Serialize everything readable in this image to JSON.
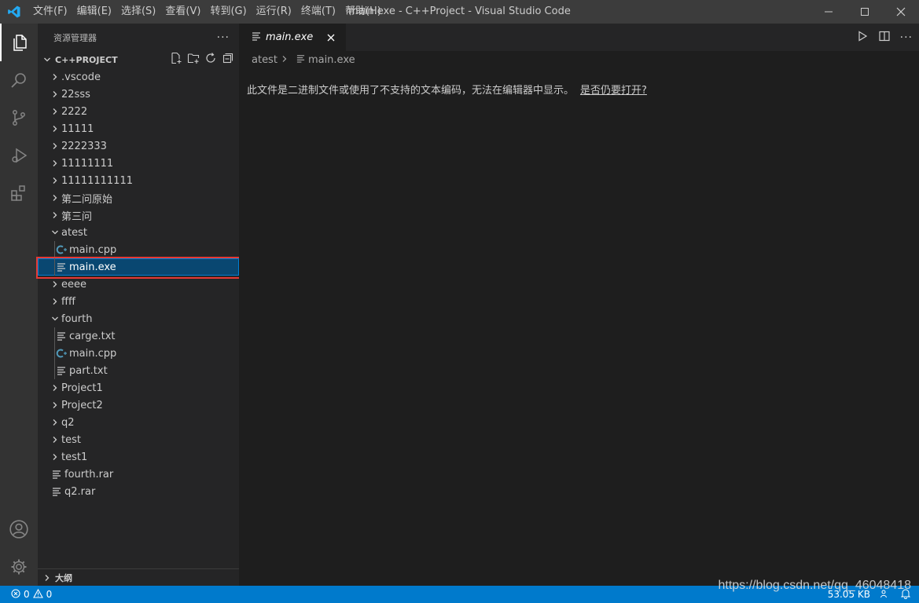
{
  "titlebar": {
    "menu": [
      "文件(F)",
      "编辑(E)",
      "选择(S)",
      "查看(V)",
      "转到(G)",
      "运行(R)",
      "终端(T)",
      "帮助(H)"
    ],
    "window_title": "main.exe - C++Project - Visual Studio Code"
  },
  "sidebar": {
    "title": "资源管理器",
    "more": "···",
    "project": "C++PROJECT",
    "tree": [
      {
        "label": ".vscode",
        "type": "folder",
        "expanded": false,
        "depth": 0
      },
      {
        "label": "22sss",
        "type": "folder",
        "expanded": false,
        "depth": 0
      },
      {
        "label": "2222",
        "type": "folder",
        "expanded": false,
        "depth": 0
      },
      {
        "label": "11111",
        "type": "folder",
        "expanded": false,
        "depth": 0
      },
      {
        "label": "2222333",
        "type": "folder",
        "expanded": false,
        "depth": 0
      },
      {
        "label": "11111111",
        "type": "folder",
        "expanded": false,
        "depth": 0
      },
      {
        "label": "11111111111",
        "type": "folder",
        "expanded": false,
        "depth": 0
      },
      {
        "label": "第二问原始",
        "type": "folder",
        "expanded": false,
        "depth": 0
      },
      {
        "label": "第三问",
        "type": "folder",
        "expanded": false,
        "depth": 0
      },
      {
        "label": "atest",
        "type": "folder",
        "expanded": true,
        "depth": 0
      },
      {
        "label": "main.cpp",
        "type": "cpp",
        "depth": 1
      },
      {
        "label": "main.exe",
        "type": "file",
        "depth": 1,
        "selected": true
      },
      {
        "label": "eeee",
        "type": "folder",
        "expanded": false,
        "depth": 0
      },
      {
        "label": "ffff",
        "type": "folder",
        "expanded": false,
        "depth": 0
      },
      {
        "label": "fourth",
        "type": "folder",
        "expanded": true,
        "depth": 0
      },
      {
        "label": "carge.txt",
        "type": "file",
        "depth": 1
      },
      {
        "label": "main.cpp",
        "type": "cpp",
        "depth": 1
      },
      {
        "label": "part.txt",
        "type": "file",
        "depth": 1
      },
      {
        "label": "Project1",
        "type": "folder",
        "expanded": false,
        "depth": 0
      },
      {
        "label": "Project2",
        "type": "folder",
        "expanded": false,
        "depth": 0
      },
      {
        "label": "q2",
        "type": "folder",
        "expanded": false,
        "depth": 0
      },
      {
        "label": "test",
        "type": "folder",
        "expanded": false,
        "depth": 0
      },
      {
        "label": "test1",
        "type": "folder",
        "expanded": false,
        "depth": 0
      },
      {
        "label": "fourth.rar",
        "type": "file",
        "depth": 0,
        "root_file": true
      },
      {
        "label": "q2.rar",
        "type": "file",
        "depth": 0,
        "root_file": true
      }
    ],
    "outline": "大纲"
  },
  "editor": {
    "tab_label": "main.exe",
    "breadcrumb_folder": "atest",
    "breadcrumb_file": "main.exe",
    "binary_message": "此文件是二进制文件或使用了不支持的文本编码，无法在编辑器中显示。",
    "open_anyway": "是否仍要打开?"
  },
  "statusbar": {
    "errors": "0",
    "warnings": "0",
    "file_size": "53.05 KB"
  },
  "watermark": "https://blog.csdn.net/qq_46048418",
  "colors": {
    "accent": "#007acc",
    "selection": "#094771",
    "highlight_box": "#e53935"
  }
}
